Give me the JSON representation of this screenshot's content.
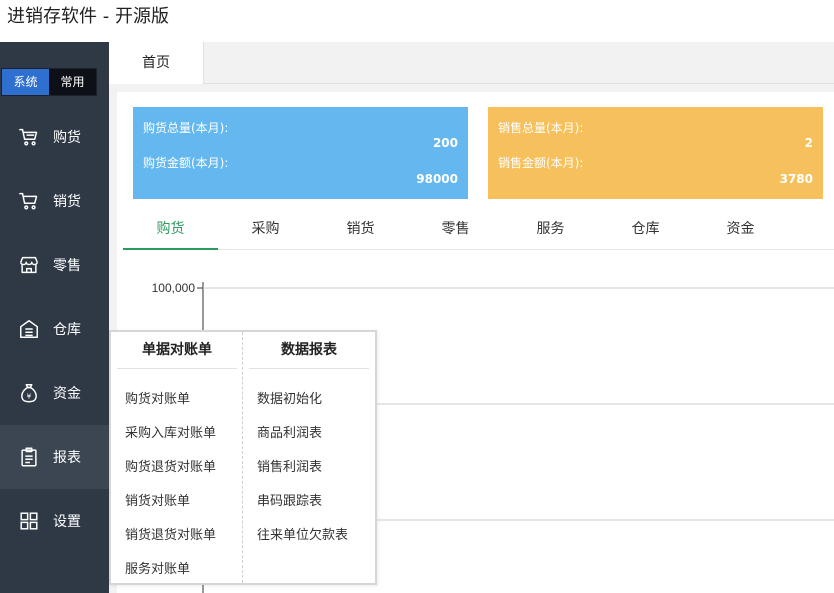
{
  "app": {
    "title": "进销存软件 - 开源版"
  },
  "sidebar": {
    "mode_system": "系统",
    "mode_common": "常用",
    "items": [
      {
        "label": "购货",
        "icon": "cart-icon"
      },
      {
        "label": "销货",
        "icon": "cart-icon"
      },
      {
        "label": "零售",
        "icon": "store-icon"
      },
      {
        "label": "仓库",
        "icon": "warehouse-icon"
      },
      {
        "label": "资金",
        "icon": "money-bag-icon"
      },
      {
        "label": "报表",
        "icon": "clipboard-icon"
      },
      {
        "label": "设置",
        "icon": "grid-icon"
      }
    ],
    "active_item": "报表"
  },
  "tabs": [
    {
      "label": "首页"
    }
  ],
  "stats": {
    "purchase": {
      "total_label": "购货总量(本月):",
      "total_value": "200",
      "amount_label": "购货金额(本月):",
      "amount_value": "98000",
      "color": "#65b8ef"
    },
    "sales": {
      "total_label": "销售总量(本月):",
      "total_value": "2",
      "amount_label": "销售金额(本月):",
      "amount_value": "3780",
      "color": "#f6c15c"
    }
  },
  "subtabs": [
    "购货",
    "采购",
    "销货",
    "零售",
    "服务",
    "仓库",
    "资金"
  ],
  "active_subtab": "购货",
  "chart": {
    "y_tick_visible": "100,000"
  },
  "popup": {
    "left_header": "单据对账单",
    "left_items": [
      "购货对账单",
      "采购入库对账单",
      "购货退货对账单",
      "销货对账单",
      "销货退货对账单",
      "服务对账单"
    ],
    "right_header": "数据报表",
    "right_items": [
      "数据初始化",
      "商品利润表",
      "销售利润表",
      "串码跟踪表",
      "往来单位欠款表"
    ]
  },
  "colors": {
    "sidebar_bg": "#2f3946",
    "accent_blue": "#2f6fd0",
    "accent_green": "#2d9b5f"
  }
}
